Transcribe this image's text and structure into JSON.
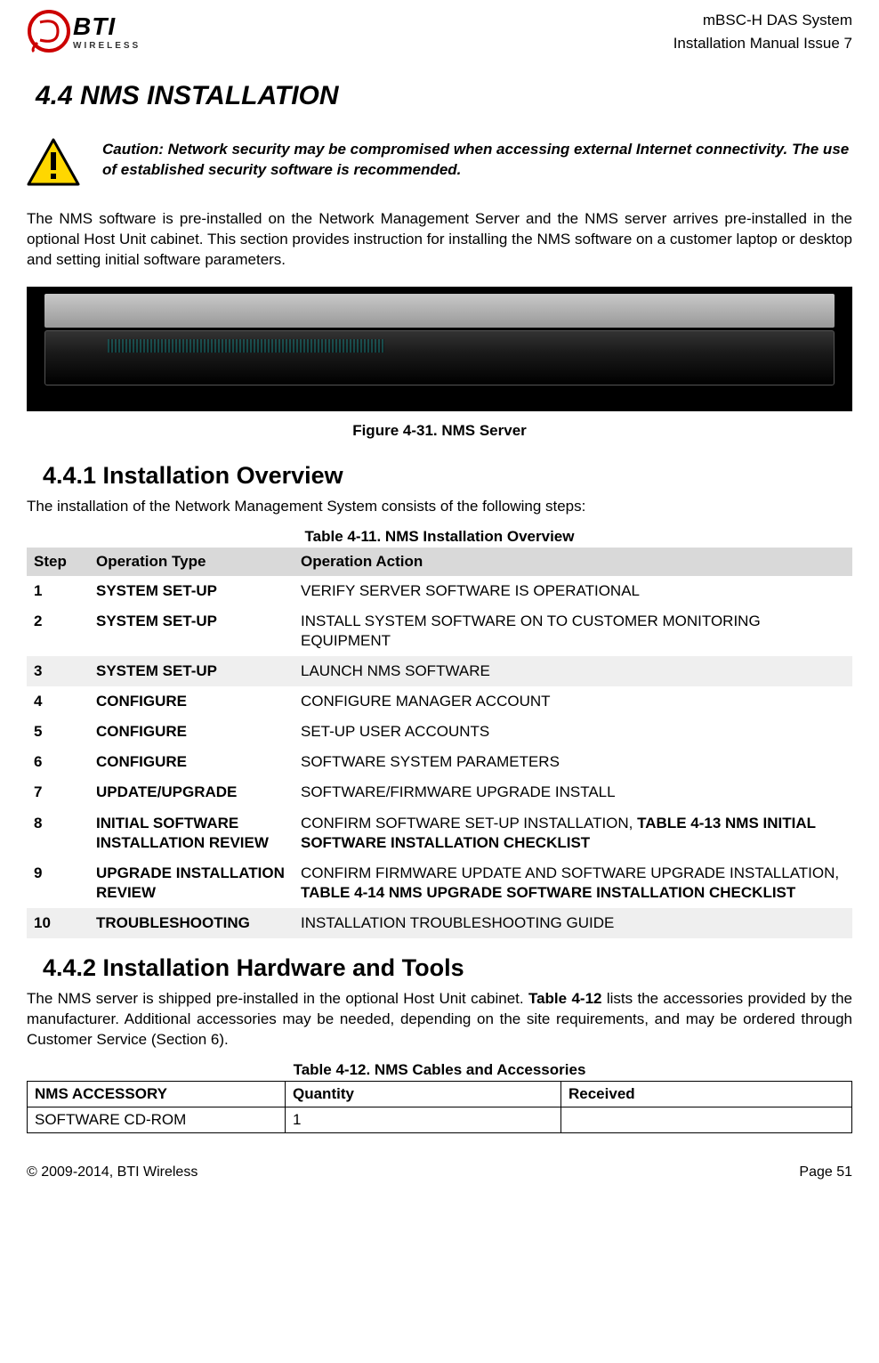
{
  "header": {
    "logo_main": "BTI",
    "logo_sub": "WIRELESS",
    "line1": "mBSC-H DAS System",
    "line2": "Installation Manual Issue 7"
  },
  "section": {
    "number_title": "4.4   NMS INSTALLATION",
    "caution": "Caution: Network security may be compromised when accessing external Internet connectivity. The use of established security software is recommended.",
    "intro": "The NMS software is pre-installed on the Network Management Server and the NMS server arrives pre-installed in the optional Host Unit cabinet. This section provides instruction for installing the NMS software on a customer laptop or desktop and setting initial software parameters.",
    "figure_caption": "Figure 4-31. NMS Server"
  },
  "sub1": {
    "title": "4.4.1  Installation Overview",
    "text": "The installation of the Network Management System consists of the following steps:",
    "table_caption": "Table 4-11. NMS Installation Overview",
    "headers": {
      "step": "Step",
      "optype": "Operation Type",
      "action": "Operation Action"
    },
    "rows": [
      {
        "step": "1",
        "optype": "SYSTEM SET-UP",
        "action_plain": "VERIFY SERVER SOFTWARE IS OPERATIONAL",
        "shade": false
      },
      {
        "step": "2",
        "optype": "SYSTEM SET-UP",
        "action_plain": "INSTALL SYSTEM SOFTWARE ON TO CUSTOMER MONITORING EQUIPMENT",
        "shade": false
      },
      {
        "step": "3",
        "optype": "SYSTEM SET-UP",
        "action_plain": "LAUNCH NMS SOFTWARE",
        "shade": true
      },
      {
        "step": "4",
        "optype": "CONFIGURE",
        "action_plain": "CONFIGURE MANAGER ACCOUNT",
        "shade": false
      },
      {
        "step": "5",
        "optype": "CONFIGURE",
        "action_plain": "SET-UP USER ACCOUNTS",
        "shade": false
      },
      {
        "step": "6",
        "optype": "CONFIGURE",
        "action_plain": "SOFTWARE SYSTEM PARAMETERS",
        "shade": false
      },
      {
        "step": "7",
        "optype": "UPDATE/UPGRADE",
        "action_plain": "SOFTWARE/FIRMWARE UPGRADE INSTALL",
        "shade": false
      },
      {
        "step": "8",
        "optype": "INITIAL SOFTWARE INSTALLATION REVIEW",
        "action_prefix": "CONFIRM SOFTWARE SET-UP INSTALLATION, ",
        "action_bold": "TABLE 4-13 NMS INITIAL SOFTWARE INSTALLATION CHECKLIST",
        "shade": false
      },
      {
        "step": "9",
        "optype": "UPGRADE INSTALLATION REVIEW",
        "action_prefix": "CONFIRM FIRMWARE UPDATE AND SOFTWARE UPGRADE INSTALLATION, ",
        "action_bold": "TABLE 4-14 NMS UPGRADE SOFTWARE INSTALLATION CHECKLIST",
        "shade": false
      },
      {
        "step": "10",
        "optype": "TROUBLESHOOTING",
        "action_plain": "INSTALLATION TROUBLESHOOTING GUIDE",
        "shade": true
      }
    ]
  },
  "sub2": {
    "title": "4.4.2  Installation Hardware and Tools",
    "text_pre": "The NMS server is shipped pre-installed in the optional Host Unit cabinet. ",
    "text_bold": "Table 4-12",
    "text_post": " lists the accessories provided by the manufacturer. Additional accessories may be needed, depending on the site requirements, and may be ordered through Customer Service (Section 6).",
    "table_caption": "Table 4-12. NMS Cables and Accessories",
    "headers": {
      "acc": "NMS ACCESSORY",
      "qty": "Quantity",
      "recv": "Received"
    },
    "rows": [
      {
        "acc": "SOFTWARE CD-ROM",
        "qty": "1",
        "recv": ""
      }
    ]
  },
  "footer": {
    "left": "© 2009-2014, BTI Wireless",
    "right": "Page 51"
  }
}
